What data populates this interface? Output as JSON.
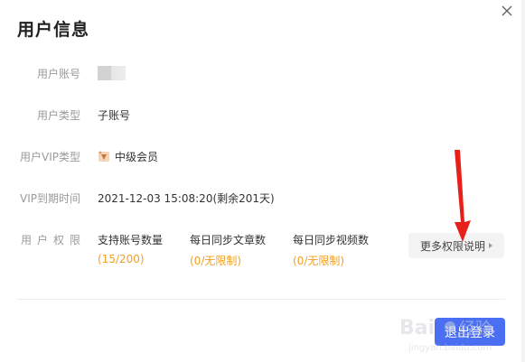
{
  "dialog": {
    "title": "用户信息"
  },
  "rows": {
    "account": {
      "label": "用户账号"
    },
    "type": {
      "label": "用户类型",
      "value": "子账号"
    },
    "vip_type": {
      "label": "用户VIP类型",
      "value": "中级会员"
    },
    "vip_expire": {
      "label": "VIP到期时间",
      "value": "2021-12-03 15:08:20(剩余201天)"
    },
    "permissions": {
      "label": "用户权限"
    }
  },
  "permissions": [
    {
      "title": "支持账号数量",
      "value": "(15/200)"
    },
    {
      "title": "每日同步文章数",
      "value": "(0/无限制)"
    },
    {
      "title": "每日同步视频数",
      "value": "(0/无限制)"
    }
  ],
  "buttons": {
    "more_permissions": "更多权限说明",
    "logout": "退出登录"
  },
  "colors": {
    "primary": "#4a6ff2",
    "highlight": "#f0a020",
    "annotation_arrow": "#e8201c"
  },
  "icons": {
    "close": "close-icon",
    "vip": "vip-badge-icon",
    "more": "caret-right-icon"
  }
}
